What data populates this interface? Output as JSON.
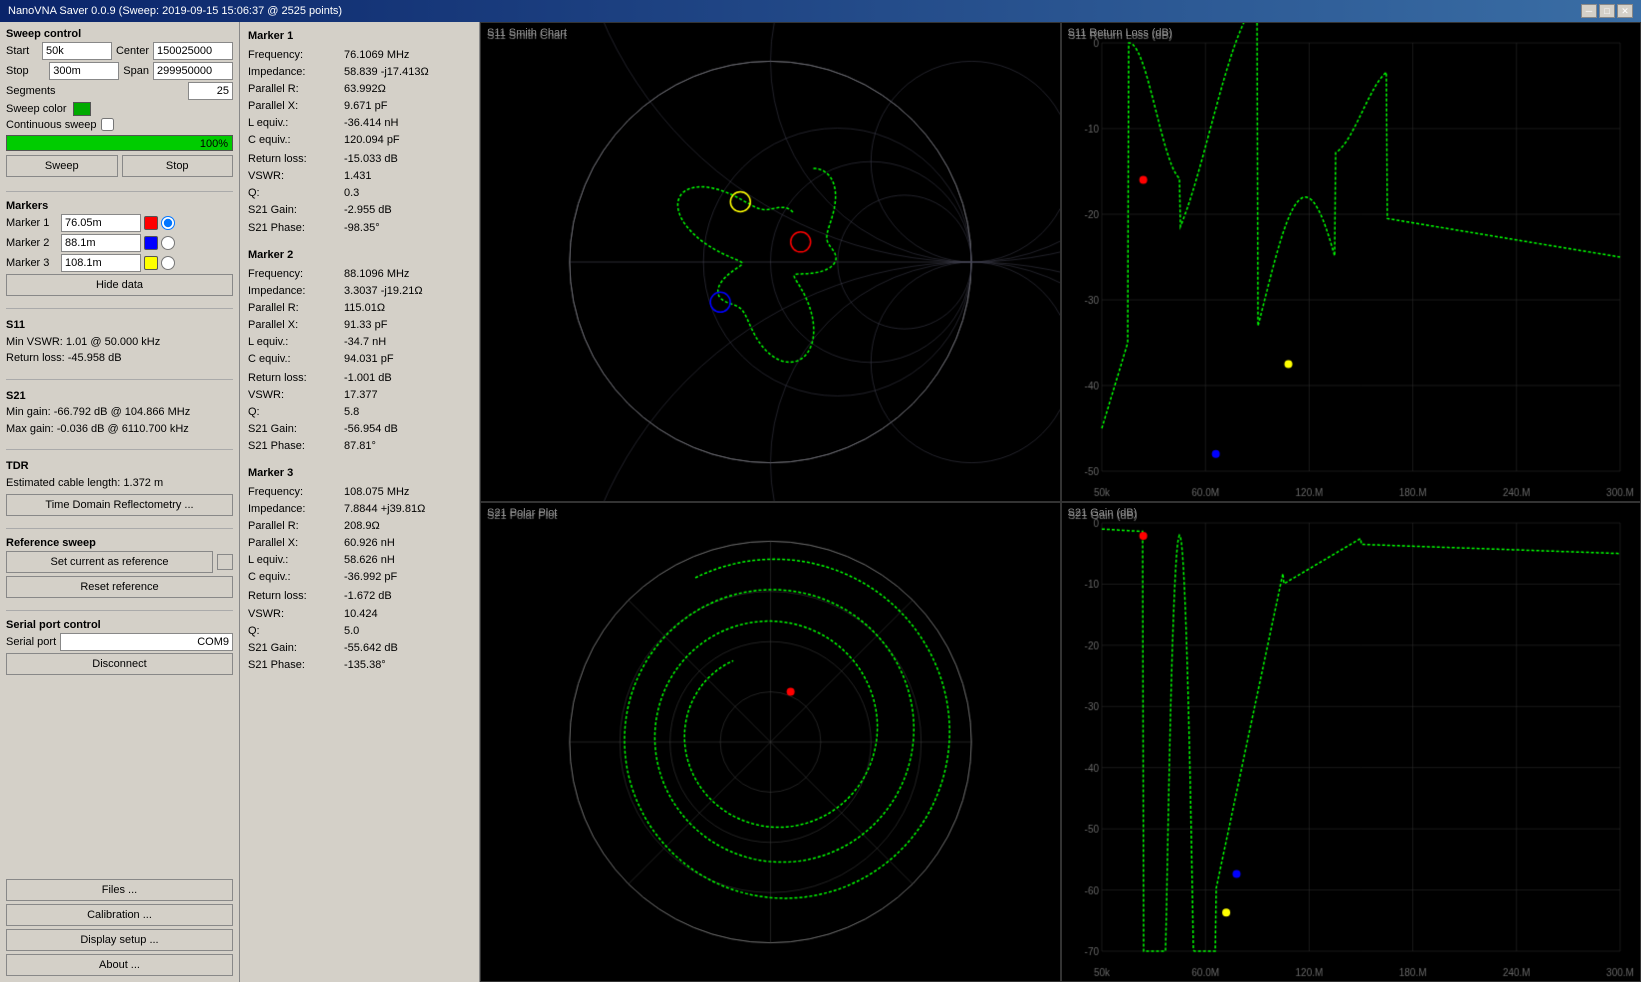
{
  "titleBar": {
    "title": "NanoVNA Saver 0.0.9 (Sweep: 2019-09-15 15:06:37 @ 2525 points)"
  },
  "sweepControl": {
    "label": "Sweep control",
    "startLabel": "Start",
    "startValue": "50k",
    "centerLabel": "Center",
    "centerValue": "150025000",
    "stopLabel": "Stop",
    "stopValue": "300m",
    "spanLabel": "Span",
    "spanValue": "299950000",
    "segmentsLabel": "Segments",
    "segmentsValue": "25",
    "sweepColorLabel": "Sweep color",
    "continuousSweepLabel": "Continuous sweep",
    "progressPercent": "100%",
    "sweepBtn": "Sweep",
    "stopBtn": "Stop"
  },
  "markers": {
    "label": "Markers",
    "marker1Label": "Marker 1",
    "marker1Value": "76.05m",
    "marker2Label": "Marker 2",
    "marker2Value": "88.1m",
    "marker3Label": "Marker 3",
    "marker3Value": "108.1m",
    "hideDataBtn": "Hide data"
  },
  "s11": {
    "label": "S11",
    "minVSWR": "Min VSWR:  1.01 @ 50.000 kHz",
    "returnLoss": "Return loss:  -45.958 dB"
  },
  "s21": {
    "label": "S21",
    "minGain": "Min gain:  -66.792 dB @ 104.866 MHz",
    "maxGain": "Max gain:  -0.036 dB @ 6110.700 kHz"
  },
  "tdr": {
    "label": "TDR",
    "estimatedCable": "Estimated cable length:  1.372 m",
    "tdrBtn": "Time Domain Reflectometry ..."
  },
  "referenceSweep": {
    "label": "Reference sweep",
    "setCurrentBtn": "Set current as reference",
    "resetBtn": "Reset reference"
  },
  "serialPort": {
    "label": "Serial port control",
    "serialPortLabel": "Serial port",
    "serialPortValue": "COM9",
    "disconnectBtn": "Disconnect"
  },
  "bottomButtons": {
    "filesBtn": "Files ...",
    "calibrationBtn": "Calibration ...",
    "displaySetupBtn": "Display setup ...",
    "aboutBtn": "About ..."
  },
  "marker1Data": {
    "title": "Marker 1",
    "frequency": "76.1069 MHz",
    "impedance": "58.839 -j17.413Ω",
    "parallelR": "63.992Ω",
    "parallelX": "9.671 pF",
    "lEquiv": "-36.414 nH",
    "cEquiv": "120.094 pF",
    "returnLoss": "-15.033 dB",
    "vswr": "1.431",
    "q": "0.3",
    "s21Gain": "-2.955 dB",
    "s21Phase": "-98.35°"
  },
  "marker2Data": {
    "title": "Marker 2",
    "frequency": "88.1096 MHz",
    "impedance": "3.3037 -j19.21Ω",
    "parallelR": "115.01Ω",
    "parallelX": "91.33 pF",
    "lEquiv": "-34.7 nH",
    "cEquiv": "94.031 pF",
    "returnLoss": "-1.001 dB",
    "vswr": "17.377",
    "q": "5.8",
    "s21Gain": "-56.954 dB",
    "s21Phase": "87.81°"
  },
  "marker3Data": {
    "title": "Marker 3",
    "frequency": "108.075 MHz",
    "impedance": "7.8844 +j39.81Ω",
    "parallelR": "208.9Ω",
    "parallelX": "60.926 nH",
    "lEquiv": "58.626 nH",
    "cEquiv": "-36.992 pF",
    "returnLoss": "-1.672 dB",
    "vswr": "10.424",
    "q": "5.0",
    "s21Gain": "-55.642 dB",
    "s21Phase": "-135.38°"
  },
  "charts": {
    "smithChart": "S11 Smith Chart",
    "returnLoss": "S11 Return Loss (dB)",
    "polarPlot": "S21 Polar Plot",
    "s21Gain": "S21 Gain (dB)"
  }
}
